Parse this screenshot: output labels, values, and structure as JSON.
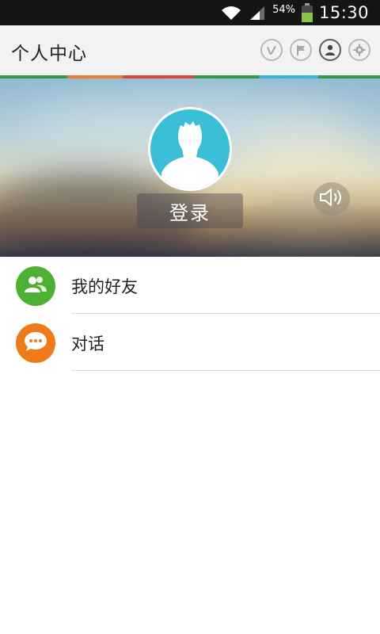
{
  "status_bar": {
    "battery_percent": "54%",
    "time": "15:30",
    "icons": [
      "wifi-icon",
      "signal-icon",
      "battery-icon"
    ]
  },
  "header": {
    "title": "个人中心",
    "actions": [
      {
        "icon": "vimeo-v-icon",
        "active": false
      },
      {
        "icon": "flag-icon",
        "active": false
      },
      {
        "icon": "person-icon",
        "active": true
      },
      {
        "icon": "gear-icon",
        "active": false
      }
    ]
  },
  "stripe_colors": [
    "#2f9a47",
    "#e8812b",
    "#d6493a",
    "#2f9a47",
    "#3bb3d9",
    "#2f9a47"
  ],
  "profile": {
    "avatar_icon": "default-avatar-icon",
    "avatar_color": "#3bbfd9",
    "login_label": "登录",
    "sound_icon": "speaker-icon"
  },
  "menu": {
    "items": [
      {
        "label": "我的好友",
        "icon": "friends-icon",
        "color": "#4cb133"
      },
      {
        "label": "对话",
        "icon": "chat-bubble-icon",
        "color": "#ee7a1a"
      }
    ]
  }
}
